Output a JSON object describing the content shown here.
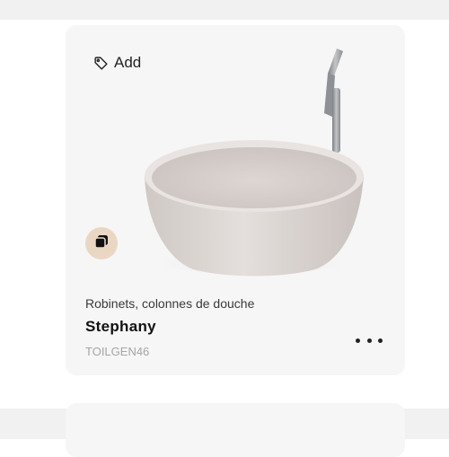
{
  "card": {
    "add_label": "Add",
    "category": "Robinets, colonnes de douche",
    "name": "Stephany",
    "sku": "TOILGEN46",
    "image_alt": "Stephany",
    "icons": {
      "tag": "tag-icon",
      "variant": "color-swatch-icon",
      "more": "more-horizontal-icon"
    }
  },
  "colors": {
    "card_background": "#f6f6f6",
    "page_band": "#f1f1f1",
    "badge": "#ead7c3",
    "basin": "#d8d2cf",
    "faucet": "#9a9ea2"
  }
}
